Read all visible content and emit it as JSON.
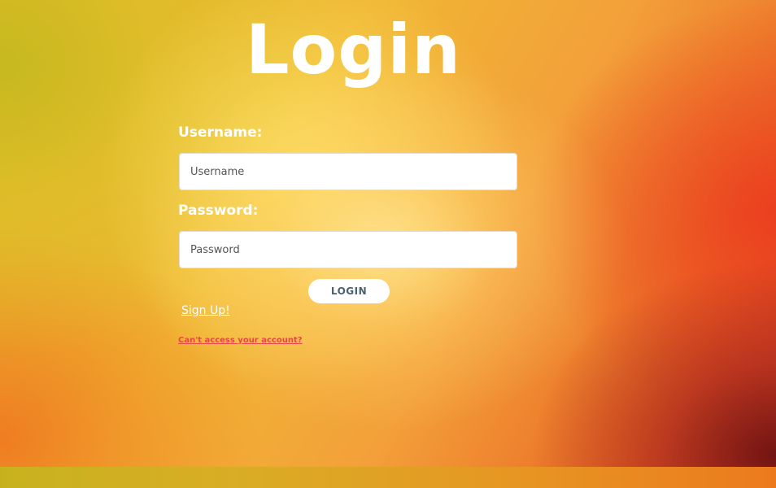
{
  "page": {
    "title": "Login"
  },
  "form": {
    "username": {
      "label": "Username:",
      "placeholder": "Username",
      "value": ""
    },
    "password": {
      "label": "Password:",
      "placeholder": "Password",
      "value": ""
    },
    "submit_label": "LOGIN",
    "signup_link": "Sign Up!",
    "forgot_link": "Can't access your account?"
  },
  "colors": {
    "accent_link": "#e8474a",
    "button_text": "#4a6170",
    "background_warm": "#f0a030",
    "background_dark": "#6e1212"
  }
}
